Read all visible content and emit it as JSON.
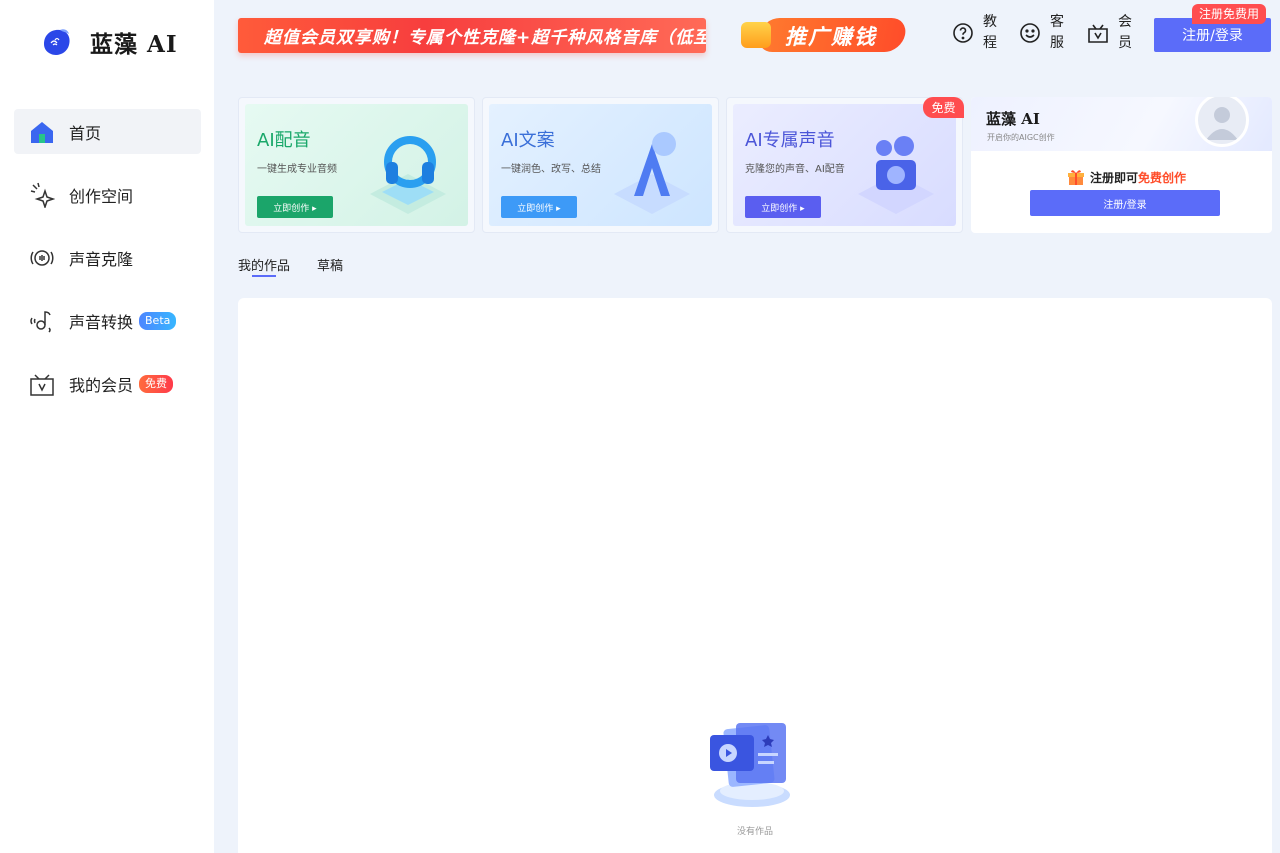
{
  "brand": {
    "name": "蓝藻 AI"
  },
  "sidebar": {
    "items": [
      {
        "label": "首页",
        "icon": "home-icon",
        "active": true,
        "badge": ""
      },
      {
        "label": "创作空间",
        "icon": "sparkle-icon",
        "active": false,
        "badge": ""
      },
      {
        "label": "声音克隆",
        "icon": "voice-wave-icon",
        "active": false,
        "badge": ""
      },
      {
        "label": "声音转换",
        "icon": "voice-convert-icon",
        "active": false,
        "badge": "Beta"
      },
      {
        "label": "我的会员",
        "icon": "vip-box-icon",
        "active": false,
        "badge": "免费"
      }
    ]
  },
  "header": {
    "promo_banner": "超值会员双享购！专属个性克隆+超千种风格音库（低至",
    "promo_earn": "推广赚钱",
    "links": [
      {
        "label": "教程",
        "icon": "help-icon"
      },
      {
        "label": "客服",
        "icon": "smile-icon"
      },
      {
        "label": "会员",
        "icon": "vip-box-icon"
      }
    ],
    "login_button": "注册/登录",
    "login_tip": "注册免费用"
  },
  "cards": [
    {
      "title": "AI配音",
      "subtitle": "一键生成专业音频",
      "button": "立即创作 ▸",
      "title_color": "#1aa86a",
      "button_color": "#1ba56a",
      "bg": "#dff7ef"
    },
    {
      "title": "AI文案",
      "subtitle": "一键润色、改写、总结",
      "button": "立即创作 ▸",
      "title_color": "#3a6fd8",
      "button_color": "#3d9af7",
      "bg": "#e0efff"
    },
    {
      "title": "AI专属声音",
      "subtitle": "克隆您的声音、AI配音",
      "button": "立即创作 ▸",
      "title_color": "#4b55d8",
      "button_color": "#5a5ef0",
      "bg": "#e5e8ff"
    }
  ],
  "free_tag": "免费",
  "profile": {
    "name": "蓝藻 AI",
    "description": "开启你的AIGC创作",
    "promo_prefix": "注册即可",
    "promo_highlight": "免费创作",
    "button": "注册/登录"
  },
  "tabs": [
    {
      "label": "我的作品",
      "active": true
    },
    {
      "label": "草稿",
      "active": false
    }
  ],
  "works": {
    "empty_text": "没有作品"
  },
  "colors": {
    "accent": "#5b6cf9",
    "red": "#ff4d4f",
    "bg": "#eef3fb"
  }
}
